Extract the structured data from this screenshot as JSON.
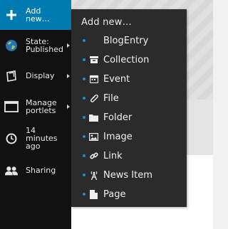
{
  "toolbar": {
    "items": [
      {
        "label": "Add\nnew…",
        "icon": "plus-icon",
        "active": true
      },
      {
        "label": "State:\nPublished",
        "icon": "state-globe-icon"
      },
      {
        "label": "Display",
        "icon": "display-icon"
      },
      {
        "label": "Manage\nportlets",
        "icon": "portlets-icon"
      },
      {
        "label": "14\nminutes\nago",
        "icon": "clock-icon"
      },
      {
        "label": "Sharing",
        "icon": "people-icon"
      }
    ]
  },
  "menu": {
    "header": "Add new…",
    "items": [
      {
        "label": "BlogEntry",
        "icon": "none"
      },
      {
        "label": "Collection",
        "icon": "collection-icon"
      },
      {
        "label": "Event",
        "icon": "calendar-icon"
      },
      {
        "label": "File",
        "icon": "paperclip-icon"
      },
      {
        "label": "Folder",
        "icon": "folder-icon"
      },
      {
        "label": "Image",
        "icon": "image-icon"
      },
      {
        "label": "Link",
        "icon": "link-icon"
      },
      {
        "label": "News Item",
        "icon": "antenna-icon"
      },
      {
        "label": "Page",
        "icon": "page-icon"
      }
    ]
  },
  "colors": {
    "toolbar_bg": "#111111",
    "active_bg": "#007bb1",
    "menu_bg": "#2b2b2b",
    "bullet": "#1d8bd6"
  }
}
